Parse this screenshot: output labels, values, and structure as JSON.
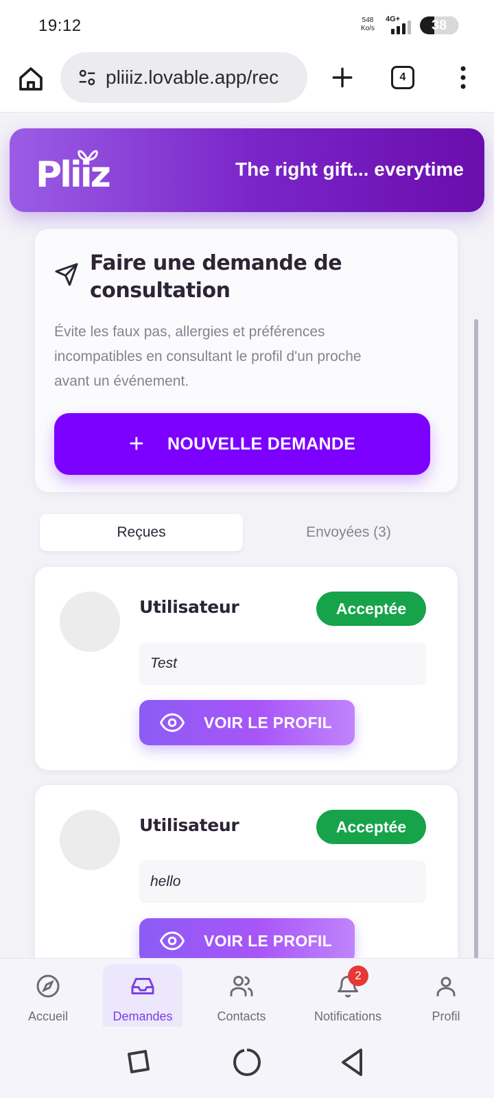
{
  "status_bar": {
    "time": "19:12",
    "speed_value": "548",
    "speed_unit": "Ko/s",
    "network": "4G+",
    "battery": "38",
    "battery_level_percent": 38
  },
  "browser": {
    "url": "pliiiz.lovable.app/rec",
    "tab_count": "4",
    "icons": [
      "home-icon",
      "site-settings-icon",
      "plus-icon",
      "more-vert-icon"
    ]
  },
  "hero": {
    "logo_text": "Pliiz",
    "tagline": "The right gift... everytime",
    "gradient": [
      "#9b5de5",
      "#6a0dad"
    ]
  },
  "consultation": {
    "icon": "send-icon",
    "title": "Faire une demande de consultation",
    "description": "Évite les faux pas, allergies et préférences incompatibles en consultant le profil d'un proche avant un événement.",
    "button_icon": "plus-icon",
    "button_label": "NOUVELLE DEMANDE",
    "accent": "#7b00ff"
  },
  "tabs": {
    "received": "Reçues",
    "sent": "Envoyées  (3)"
  },
  "requests": [
    {
      "name": "Utilisateur",
      "status": "Acceptée",
      "message": "Test",
      "button_icon": "eye-icon",
      "button_label": "VOIR LE PROFIL"
    },
    {
      "name": "Utilisateur",
      "status": "Acceptée",
      "message": "hello",
      "button_icon": "eye-icon",
      "button_label": "VOIR LE PROFIL"
    }
  ],
  "status_color": "#16a34a",
  "bottom_nav": {
    "items": [
      {
        "label": "Accueil",
        "icon": "compass-icon"
      },
      {
        "label": "Demandes",
        "icon": "inbox-icon",
        "active": true
      },
      {
        "label": "Contacts",
        "icon": "users-icon"
      },
      {
        "label": "Notifications",
        "icon": "bell-icon",
        "badge": "2"
      },
      {
        "label": "Profil",
        "icon": "user-icon"
      }
    ]
  },
  "system_nav": [
    "recents-icon",
    "home-circle-icon",
    "back-icon"
  ]
}
